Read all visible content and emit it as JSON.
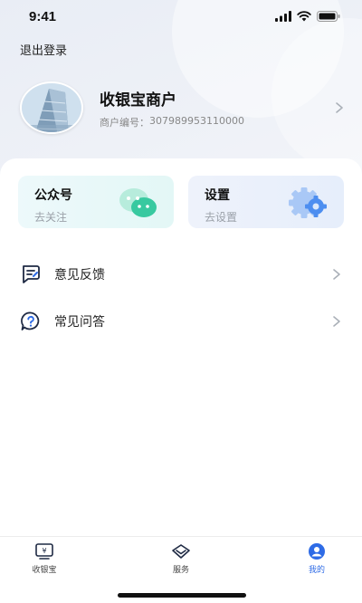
{
  "status_bar": {
    "time": "9:41"
  },
  "header": {
    "logout_label": "退出登录",
    "merchant_name": "收银宝商户",
    "merchant_id_label": "商户编号：",
    "merchant_id_value": "307989953110000"
  },
  "cards": [
    {
      "title": "公众号",
      "subtitle": "去关注",
      "icon": "wechat-icon"
    },
    {
      "title": "设置",
      "subtitle": "去设置",
      "icon": "gear-icon"
    }
  ],
  "menu": [
    {
      "label": "意见反馈",
      "icon": "feedback-icon"
    },
    {
      "label": "常见问答",
      "icon": "faq-icon"
    }
  ],
  "tabbar": {
    "items": [
      {
        "label": "收银宝",
        "icon": "register-icon",
        "active": false
      },
      {
        "label": "服务",
        "icon": "service-icon",
        "active": false
      },
      {
        "label": "我的",
        "icon": "profile-icon",
        "active": true
      }
    ]
  },
  "colors": {
    "accent": "#2e6be6",
    "wechat_green": "#38c9a0",
    "gear_blue": "#4d8ef0"
  }
}
